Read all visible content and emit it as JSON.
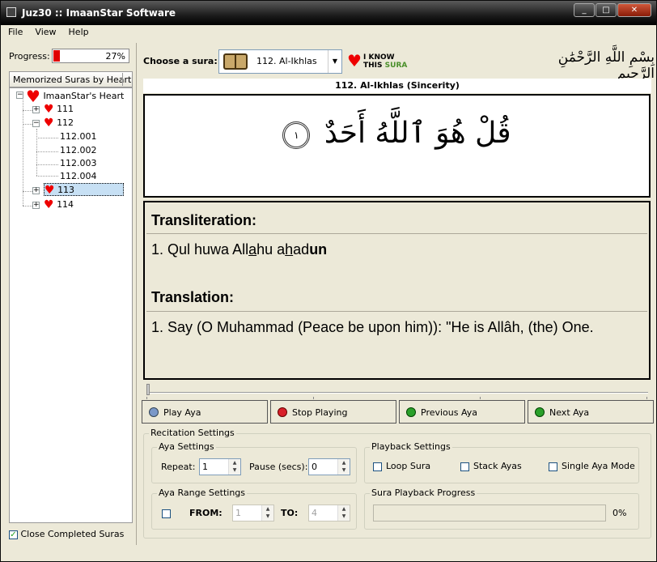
{
  "window": {
    "title": "Juz30 :: ImaanStar Software",
    "buttons": [
      "_",
      "□",
      "✕"
    ]
  },
  "menu": [
    "File",
    "View",
    "Help"
  ],
  "left": {
    "progress_label": "Progress:",
    "progress_value": 0.27,
    "progress_text": "27%",
    "memorized_header": "Memorized Suras by Heart",
    "tree_root": "ImaanStar's Heart",
    "tree_items": [
      {
        "label": "111",
        "expander": "+"
      },
      {
        "label": "112",
        "expander": "−"
      },
      {
        "label": "112.001"
      },
      {
        "label": "112.002"
      },
      {
        "label": "112.003"
      },
      {
        "label": "112.004"
      },
      {
        "label": "113",
        "expander": "+",
        "selected": true
      },
      {
        "label": "114",
        "expander": "+"
      }
    ],
    "close_completed_label": "Close Completed Suras",
    "close_completed_checked": true
  },
  "header": {
    "choose_label": "Choose a sura:",
    "sura_selected": "112. Al-Ikhlas",
    "iknow_line1": "I KNOW",
    "iknow_line2": "THIS",
    "iknow_line2_accent": "SURA",
    "basmala": "بِسْمِ اللَّهِ الرَّحْمَٰنِ الرَّحِيمِ"
  },
  "sura_title": "112. Al-Ikhlas (Sincerity)",
  "arabic": {
    "text": "قُلْ هُوَ ٱللَّهُ أَحَدٌ",
    "aya_number": "١"
  },
  "translit": {
    "heading": "Transliteration:",
    "text_parts": [
      "1. Qul huwa All",
      "a",
      "hu a",
      "h",
      "ad",
      "un"
    ]
  },
  "translation": {
    "heading": "Translation:",
    "text": "1. Say (O Muhammad (Peace be upon him)): \"He is Allâh, (the) One."
  },
  "controls": {
    "play": "Play Aya",
    "stop": "Stop Playing",
    "previous": "Previous Aya",
    "next": "Next Aya"
  },
  "recitation": {
    "title": "Recitation Settings",
    "aya_settings": "Aya Settings",
    "repeat_label": "Repeat:",
    "repeat_value": "1",
    "pause_label": "Pause (secs):",
    "pause_value": "0",
    "playback_settings": "Playback Settings",
    "loop_sura": "Loop Sura",
    "stack_ayas": "Stack Ayas",
    "single_aya": "Single Aya Mode",
    "range_settings": "Aya Range Settings",
    "from_label": "FROM:",
    "from_value": "1",
    "to_label": "TO:",
    "to_value": "4",
    "playback_progress_label": "Sura Playback Progress",
    "playback_progress_value": 0,
    "playback_progress_text": "0%"
  },
  "colors": {
    "accent_red": "#e00000",
    "selection": "#c7e0f4",
    "brand_green": "#4a8f2a"
  }
}
